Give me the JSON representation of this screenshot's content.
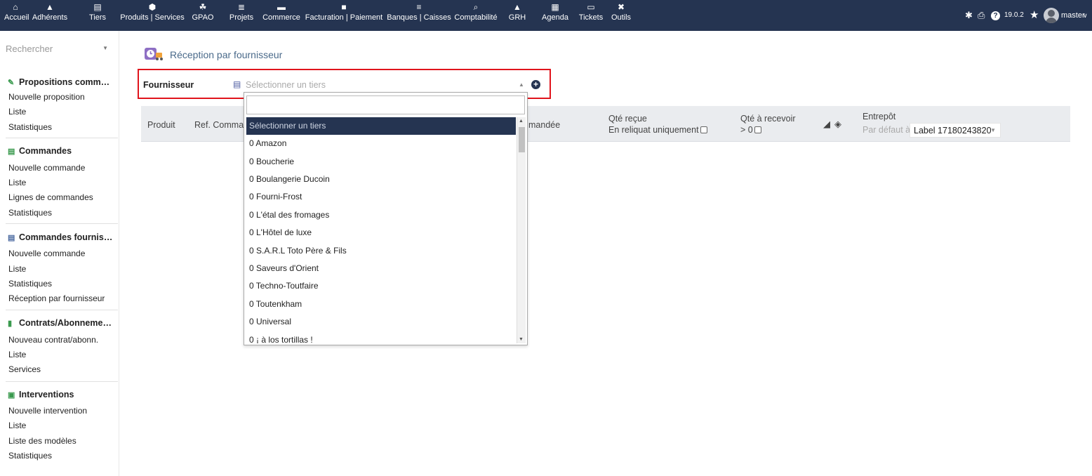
{
  "topnav": {
    "items": [
      {
        "label": "Accueil",
        "icon": "home-icon"
      },
      {
        "label": "Adhérents",
        "icon": "user-icon"
      },
      {
        "label": "Tiers",
        "icon": "building-icon"
      },
      {
        "label": "Produits | Services",
        "icon": "cube-icon"
      },
      {
        "label": "GPAO",
        "icon": "cubes-icon"
      },
      {
        "label": "Projets",
        "icon": "sitemap-icon"
      },
      {
        "label": "Commerce",
        "icon": "suitcase-icon"
      },
      {
        "label": "Facturation | Paiement",
        "icon": "file-invoice-icon"
      },
      {
        "label": "Banques | Caisses",
        "icon": "bank-icon"
      },
      {
        "label": "Comptabilité",
        "icon": "search-dollar-icon"
      },
      {
        "label": "GRH",
        "icon": "user-tie-icon"
      },
      {
        "label": "Agenda",
        "icon": "calendar-icon"
      },
      {
        "label": "Tickets",
        "icon": "ticket-icon"
      },
      {
        "label": "Outils",
        "icon": "tools-icon"
      }
    ],
    "version": "19.0.2",
    "user": "master"
  },
  "sidebar": {
    "search_placeholder": "Rechercher",
    "sections": [
      {
        "title": "Propositions comm…",
        "icon": "file-signature-icon",
        "links": [
          "Nouvelle proposition",
          "Liste",
          "Statistiques"
        ]
      },
      {
        "title": "Commandes",
        "icon": "file-text-icon",
        "links": [
          "Nouvelle commande",
          "Liste",
          "Lignes de commandes",
          "Statistiques"
        ]
      },
      {
        "title": "Commandes fournis…",
        "icon": "file-dollar-icon",
        "links": [
          "Nouvelle commande",
          "Liste",
          "Statistiques",
          "Réception par fournisseur"
        ]
      },
      {
        "title": "Contrats/Abonneme…",
        "icon": "suitcase-icon",
        "links": [
          "Nouveau contrat/abonn.",
          "Liste",
          "Services"
        ]
      },
      {
        "title": "Interventions",
        "icon": "ambulance-icon",
        "links": [
          "Nouvelle intervention",
          "Liste",
          "Liste des modèles",
          "Statistiques"
        ]
      }
    ]
  },
  "main": {
    "title": "Réception par fournisseur",
    "supplier_label": "Fournisseur",
    "supplier_placeholder": "Sélectionner un tiers",
    "table_headers": {
      "produit": "Produit",
      "ref": "Ref. Commar",
      "commandee": "mandée",
      "qte_recue": "Qté reçue",
      "reliquat": "En reliquat uniquement",
      "qte_recevoir": "Qté à recevoir",
      "gt_zero": "> 0",
      "entrepot": "Entrepôt",
      "par_defaut": "Par défaut à",
      "warehouse_value": "Label 17180243820"
    }
  },
  "dropdown": {
    "selected": "Sélectionner un tiers",
    "options": [
      "0 Amazon",
      "0 Boucherie",
      "0 Boulangerie Ducoin",
      "0 Fourni-Frost",
      "0 L'étal des fromages",
      "0 L'Hôtel de luxe",
      "0 S.A.R.L Toto Père & Fils",
      "0 Saveurs d'Orient",
      "0 Techno-Toutfaire",
      "0 Toutenkham",
      "0 Universal",
      "0 ¡ à los tortillas !"
    ]
  }
}
